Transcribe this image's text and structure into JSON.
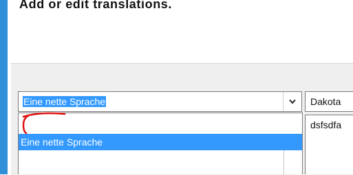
{
  "header": {
    "title": "Add or edit translations."
  },
  "language_combo": {
    "selected_value": "Eine nette Sprache",
    "dropdown_icon": "chevron-down-icon"
  },
  "language_dropdown": {
    "items": [
      {
        "label": ""
      },
      {
        "label": "Eine nette Sprache"
      }
    ]
  },
  "second_combo": {
    "value": "Dakota"
  },
  "translation_text": {
    "value": "dsfsdfa"
  },
  "colors": {
    "selection": "#3399ff",
    "accent_stripe": "#2f8fd8",
    "annotation": "#e01010"
  }
}
